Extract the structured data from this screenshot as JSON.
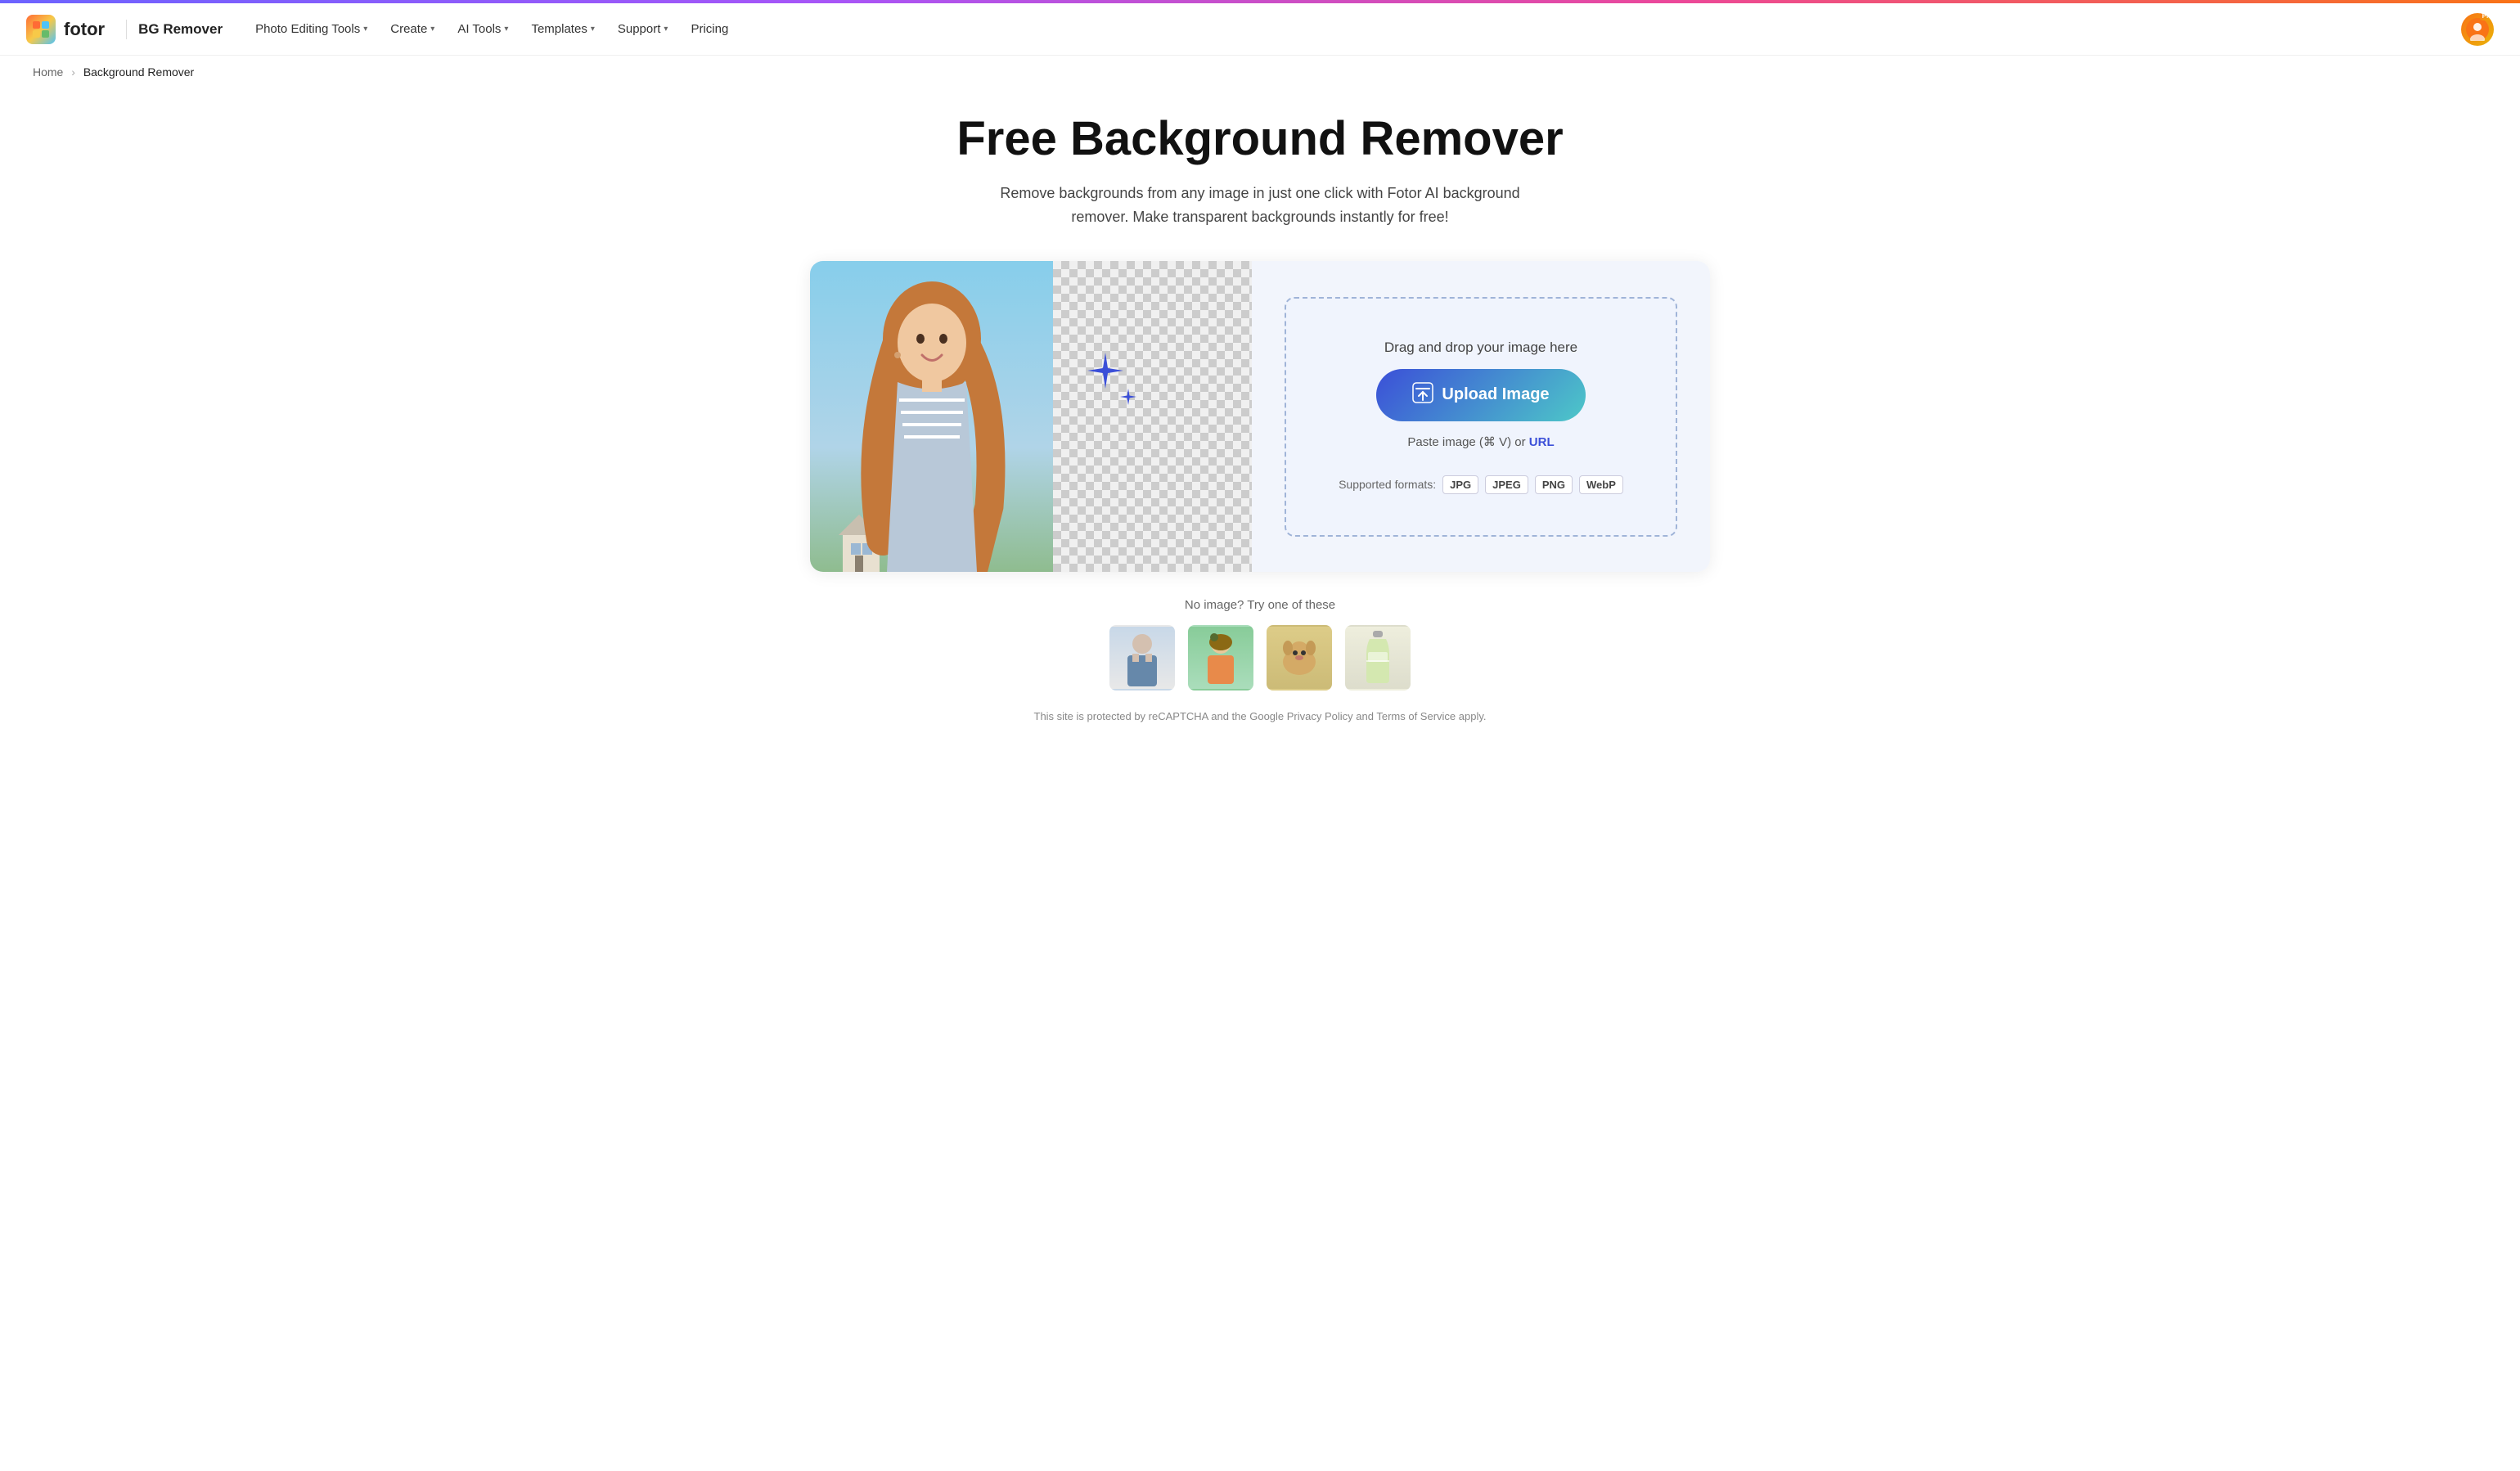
{
  "topbar": {
    "brand": "fotor",
    "bg_remover": "BG Remover"
  },
  "nav": {
    "items": [
      {
        "label": "Photo Editing Tools",
        "has_dropdown": true
      },
      {
        "label": "Create",
        "has_dropdown": true
      },
      {
        "label": "AI Tools",
        "has_dropdown": true
      },
      {
        "label": "Templates",
        "has_dropdown": true
      },
      {
        "label": "Support",
        "has_dropdown": true
      },
      {
        "label": "Pricing",
        "has_dropdown": false
      }
    ]
  },
  "breadcrumb": {
    "home": "Home",
    "current": "Background Remover"
  },
  "hero": {
    "title": "Free Background Remover",
    "subtitle": "Remove backgrounds from any image in just one click with Fotor AI background remover. Make transparent backgrounds instantly for free!"
  },
  "dropzone": {
    "drag_text": "Drag and drop your image here",
    "upload_btn": "Upload Image",
    "paste_text": "Paste image (⌘ V) or",
    "url_link": "URL",
    "formats_label": "Supported formats:",
    "formats": [
      "JPG",
      "JPEG",
      "PNG",
      "WebP"
    ]
  },
  "samples": {
    "label": "No image? Try one of these",
    "items": [
      {
        "type": "man",
        "emoji": "🧑"
      },
      {
        "type": "woman",
        "emoji": "👩"
      },
      {
        "type": "dog",
        "emoji": "🐕"
      },
      {
        "type": "bottle",
        "emoji": "🧴"
      }
    ]
  },
  "footer_note": "This site is protected by reCAPTCHA and the Google Privacy Policy and Terms of Service apply."
}
